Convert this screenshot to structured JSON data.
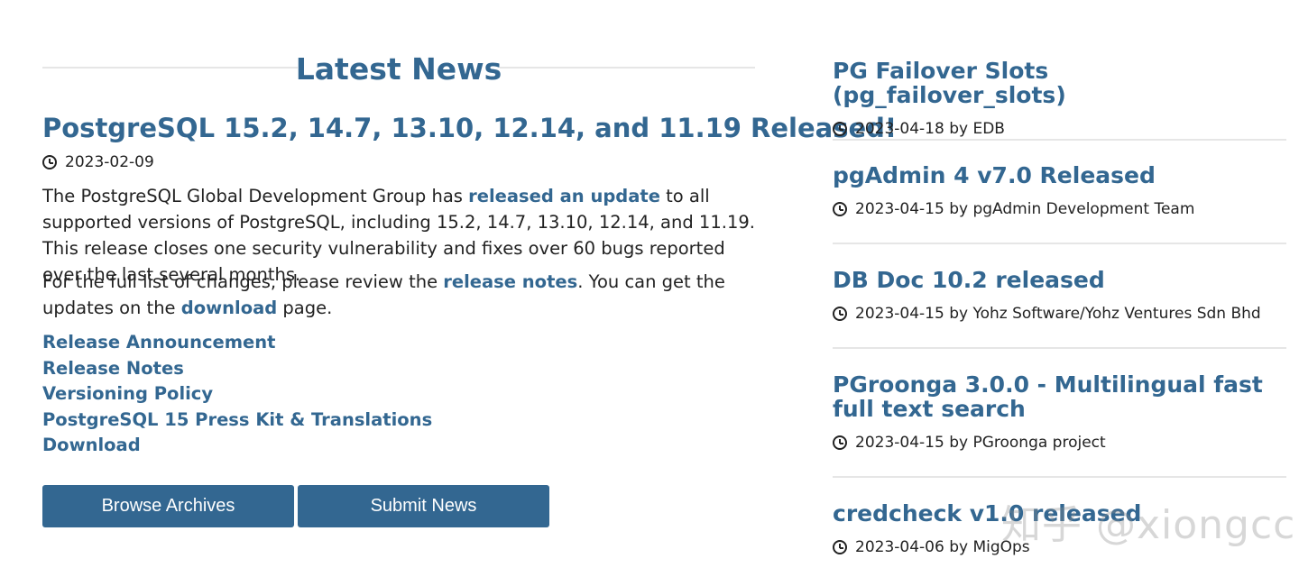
{
  "heading": "Latest News",
  "article": {
    "title": "PostgreSQL 15.2, 14.7, 13.10, 12.14, and 11.19 Released!",
    "date": "2023-02-09",
    "p1_before": "The PostgreSQL Global Development Group has ",
    "p1_link": "released an update",
    "p1_after": " to all supported versions of PostgreSQL, including 15.2, 14.7, 13.10, 12.14, and 11.19. This release closes one security vulnerability and fixes over 60 bugs reported over the last several months.",
    "p2_before": "For the full list of changes, please review the ",
    "p2_link1": "release notes",
    "p2_middle": ". You can get the updates on the ",
    "p2_link2": "download",
    "p2_after": " page.",
    "links": [
      "Release Announcement",
      "Release Notes",
      "Versioning Policy",
      "PostgreSQL 15 Press Kit & Translations",
      "Download"
    ]
  },
  "buttons": {
    "browse": "Browse Archives",
    "submit": "Submit News"
  },
  "news": [
    {
      "title": "PG Failover Slots (pg_failover_slots)",
      "meta": "2023-04-18 by EDB"
    },
    {
      "title": "pgAdmin 4 v7.0 Released",
      "meta": "2023-04-15 by pgAdmin Development Team"
    },
    {
      "title": "DB Doc 10.2 released",
      "meta": "2023-04-15 by Yohz Software/Yohz Ventures Sdn Bhd"
    },
    {
      "title": "PGroonga 3.0.0 - Multilingual fast full text search",
      "meta": "2023-04-15 by PGroonga project"
    },
    {
      "title": "credcheck v1.0 released",
      "meta": "2023-04-06 by MigOps"
    }
  ],
  "watermark": "知乎 @xiongcc",
  "colors": {
    "link": "#336791",
    "button": "#336791",
    "divider": "#e6e6e6"
  }
}
